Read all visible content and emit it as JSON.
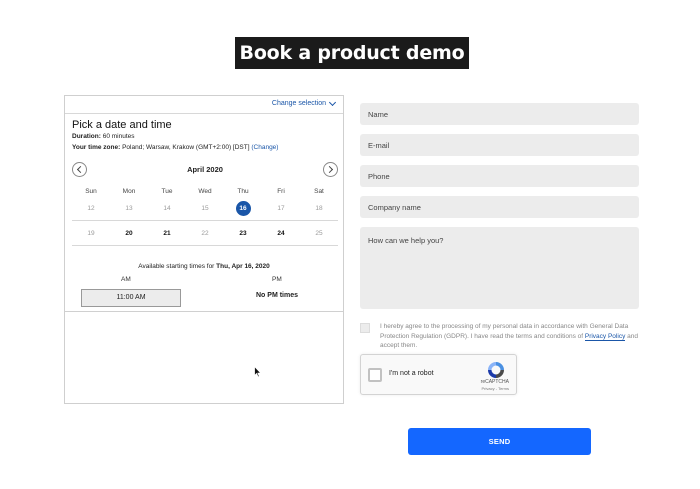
{
  "header": {
    "title": "Book a product demo"
  },
  "scheduler": {
    "change_selection": "Change selection",
    "heading": "Pick a date and time",
    "duration_label": "Duration:",
    "duration_value": "60 minutes",
    "timezone_label": "Your time zone:",
    "timezone_value": "Poland;  Warsaw, Krakow  (GMT+2:00) [DST]",
    "timezone_change": "(Change)",
    "month": "April 2020",
    "weekdays": [
      "Sun",
      "Mon",
      "Tue",
      "Wed",
      "Thu",
      "Fri",
      "Sat"
    ],
    "week1": [
      "12",
      "13",
      "14",
      "15",
      "16",
      "17",
      "18"
    ],
    "week2": [
      "19",
      "20",
      "21",
      "22",
      "23",
      "24",
      "25"
    ],
    "selected_day": "16",
    "available_prefix": "Available starting times for ",
    "available_date": "Thu, Apr 16, 2020",
    "am_label": "AM",
    "pm_label": "PM",
    "am_slot": "11:00 AM",
    "no_pm": "No PM times"
  },
  "form": {
    "name_placeholder": "Name",
    "email_placeholder": "E-mail",
    "phone_placeholder": "Phone",
    "company_placeholder": "Company name",
    "message_placeholder": "How can we help you?",
    "gdpr_text": "I hereby agree to the processing of my personal data in accordance with General Data Protection Regulation (GDPR). I have read the terms and conditions of ",
    "gdpr_link": "Privacy Policy",
    "gdpr_suffix": " and accept them.",
    "send_label": "SEND"
  },
  "recaptcha": {
    "label": "I'm not a robot",
    "brand": "reCAPTCHA",
    "terms": "Privacy - Terms"
  },
  "colors": {
    "accent": "#1a56a8",
    "send_button": "#1467ff",
    "title_bg": "#1b1b1b"
  }
}
